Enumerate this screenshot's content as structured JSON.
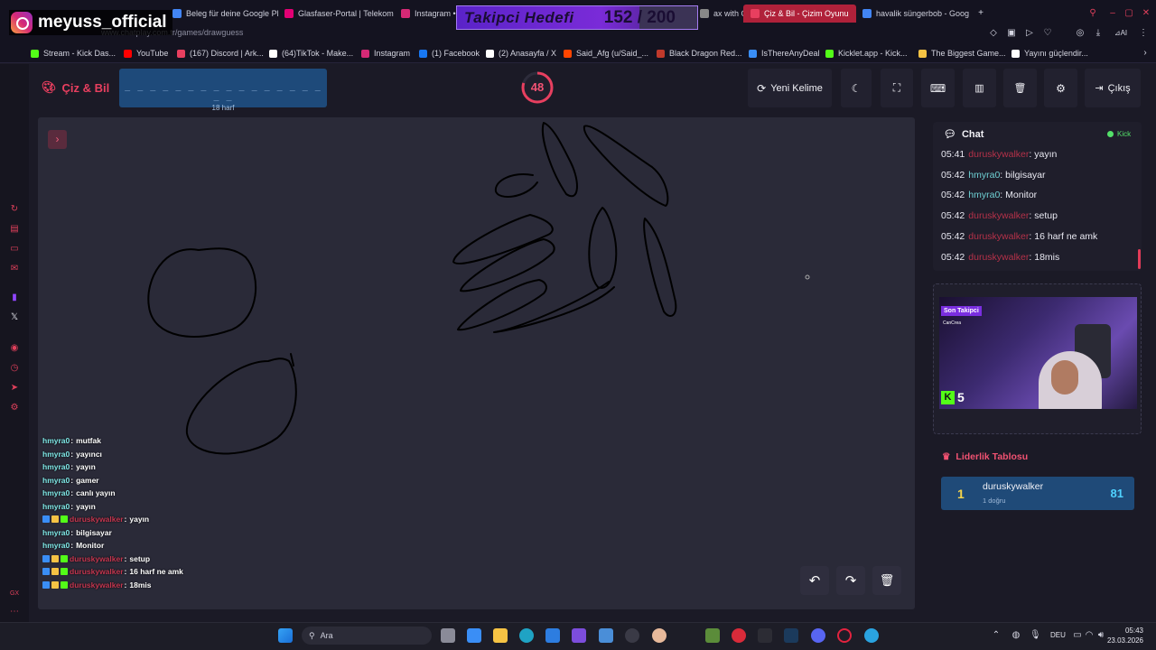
{
  "browser": {
    "url": "www.chatplay.com.tr/games/drawguess",
    "tabs": [
      {
        "label": "Beleg für deine Google Pl",
        "color": "#4285f4"
      },
      {
        "label": "Glasfaser-Portal | Telekom",
        "color": "#e20074"
      },
      {
        "label": "Instagram •",
        "color": "#d62976"
      },
      {
        "label": "ax with G",
        "color": "#888888"
      },
      {
        "label": "Çiz & Bil - Çizim Oyunu",
        "color": "#e83f5f",
        "active": true
      },
      {
        "label": "havalik süngerbob - Goog",
        "color": "#4285f4"
      }
    ],
    "bookmarks": [
      {
        "label": "Stream - Kick Das...",
        "color": "#53fc18"
      },
      {
        "label": "YouTube",
        "color": "#ff0000"
      },
      {
        "label": "(167) Discord | Ark...",
        "color": "#e83f5f"
      },
      {
        "label": "(64)TikTok - Make...",
        "color": "#ffffff"
      },
      {
        "label": "Instagram",
        "color": "#d62976"
      },
      {
        "label": "(1) Facebook",
        "color": "#1877f2"
      },
      {
        "label": "(2) Anasayfa / X",
        "color": "#ffffff"
      },
      {
        "label": "Said_Afg (u/Said_...",
        "color": "#ff4500"
      },
      {
        "label": "Black Dragon Red...",
        "color": "#c0392b"
      },
      {
        "label": "IsThereAnyDeal",
        "color": "#3a8ef6"
      },
      {
        "label": "Kicklet.app - Kick...",
        "color": "#53fc18"
      },
      {
        "label": "The Biggest Game...",
        "color": "#f6c344"
      },
      {
        "label": "Yayını güçlendir...",
        "color": "#ffffff"
      }
    ]
  },
  "overlay": {
    "streamer": "meyuss_official",
    "goal_title": "Takipci Hedefi",
    "goal_value": "152 / 200",
    "goal_progress": 0.76
  },
  "header": {
    "brand": "Çiz & Bil",
    "word_mask": "_ _ _ _ _ _ _ _ _ _ _ _ _ _ _ _ _ _",
    "letter_count": "18 harf",
    "timer": "48",
    "timer_fraction": 0.8,
    "new_word": "Yeni Kelime",
    "logout": "Çıkış"
  },
  "overlay_chat": [
    {
      "user": "hmyra0",
      "text": "mutfak",
      "type": "h"
    },
    {
      "user": "hmyra0",
      "text": "yayıncı",
      "type": "h"
    },
    {
      "user": "hmyra0",
      "text": "yayın",
      "type": "h"
    },
    {
      "user": "hmyra0",
      "text": "gamer",
      "type": "h"
    },
    {
      "user": "hmyra0",
      "text": "canlı yayın",
      "type": "h"
    },
    {
      "user": "hmyra0",
      "text": "yayın",
      "type": "h"
    },
    {
      "user": "duruskywalker",
      "text": "yayın",
      "type": "d"
    },
    {
      "user": "hmyra0",
      "text": "bilgisayar",
      "type": "h"
    },
    {
      "user": "hmyra0",
      "text": "Monitor",
      "type": "h"
    },
    {
      "user": "duruskywalker",
      "text": "setup",
      "type": "d"
    },
    {
      "user": "duruskywalker",
      "text": "16 harf ne amk",
      "type": "d"
    },
    {
      "user": "duruskywalker",
      "text": "18mis",
      "type": "d"
    }
  ],
  "chat": {
    "title": "Chat",
    "platform": "Kick",
    "messages": [
      {
        "time": "05:41",
        "user": "duruskywalker",
        "text": "yayın",
        "type": "d"
      },
      {
        "time": "05:42",
        "user": "hmyra0",
        "text": "bilgisayar",
        "type": "h"
      },
      {
        "time": "05:42",
        "user": "hmyra0",
        "text": "Monitor",
        "type": "h"
      },
      {
        "time": "05:42",
        "user": "duruskywalker",
        "text": "setup",
        "type": "d"
      },
      {
        "time": "05:42",
        "user": "duruskywalker",
        "text": "16 harf ne amk",
        "type": "d"
      },
      {
        "time": "05:42",
        "user": "duruskywalker",
        "text": "18mis",
        "type": "d"
      }
    ]
  },
  "camera": {
    "last_follower_label": "Son Takipci",
    "last_follower": "CanCrea",
    "kick_count": "5"
  },
  "leaderboard": {
    "title": "Liderlik Tablosu",
    "entries": [
      {
        "rank": "1",
        "name": "duruskywalker",
        "sub": "1 doğru",
        "score": "81"
      }
    ]
  },
  "taskbar": {
    "search": "Ara",
    "lang": "DEU",
    "time": "05:43",
    "date": "23.03.2026"
  }
}
